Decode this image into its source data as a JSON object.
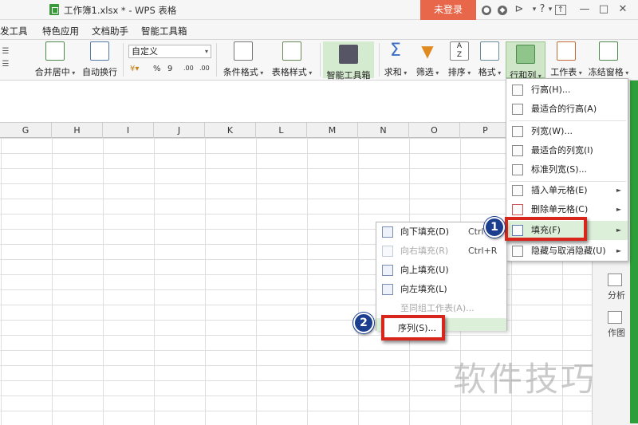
{
  "titlebar": {
    "title": "工作簿1.xlsx * - WPS 表格",
    "login_button": "未登录"
  },
  "menu_tabs": [
    "发工具",
    "特色应用",
    "文档助手",
    "智能工具箱"
  ],
  "ribbon": {
    "merge_center": "合并居中",
    "wrap_text": "自动换行",
    "number_format": "自定义",
    "percent": "%",
    "thousands": "9",
    "dec_increase": ".00",
    "dec_decrease": ".00",
    "cond_format": "条件格式",
    "table_style": "表格样式",
    "smart_toolbox": "智能工具箱",
    "sum": "求和",
    "filter": "筛选",
    "sort": "排序",
    "format": "格式",
    "row_col": "行和列",
    "worksheet": "工作表",
    "freeze": "冻结窗格"
  },
  "columns": [
    "G",
    "H",
    "I",
    "J",
    "K",
    "L",
    "M",
    "N",
    "O",
    "P"
  ],
  "main_menu": [
    {
      "label": "行高(H)...",
      "arrow": false
    },
    {
      "label": "最适合的行高(A)",
      "arrow": false
    },
    {
      "label": "列宽(W)...",
      "arrow": false
    },
    {
      "label": "最适合的列宽(I)",
      "arrow": false
    },
    {
      "label": "标准列宽(S)...",
      "arrow": false
    },
    {
      "label": "插入单元格(E)",
      "arrow": true
    },
    {
      "label": "删除单元格(C)",
      "arrow": true
    },
    {
      "label": "填充(F)",
      "arrow": true
    },
    {
      "label": "隐藏与取消隐藏(U)",
      "arrow": true
    }
  ],
  "sub_menu": [
    {
      "label": "向下填充(D)",
      "shortcut": "Ctrl+",
      "disabled": false
    },
    {
      "label": "向右填充(R)",
      "shortcut": "Ctrl+R",
      "disabled": true
    },
    {
      "label": "向上填充(U)",
      "shortcut": "",
      "disabled": false
    },
    {
      "label": "向左填充(L)",
      "shortcut": "",
      "disabled": false
    },
    {
      "label": "至同组工作表(A)...",
      "shortcut": "",
      "disabled": true
    },
    {
      "label": "序列(S)...",
      "shortcut": "",
      "disabled": false
    }
  ],
  "side_panel": {
    "analyze": "分析",
    "chart": "作图"
  },
  "annotations": {
    "step1": "1",
    "step2": "2"
  },
  "watermark": "软件技巧",
  "colors": {
    "accent_green": "#2e9e3a",
    "login_red": "#e8664a",
    "highlight_box": "#d9261c",
    "badge_blue": "#1c3e8e"
  }
}
